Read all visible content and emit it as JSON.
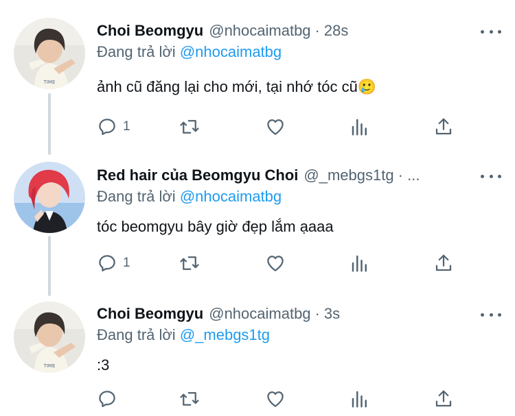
{
  "tweets": [
    {
      "name": "Choi Beomgyu",
      "handle": "@nhocaimatbg",
      "separator": "·",
      "time": "28s",
      "reply_prefix": "Đang trả lời",
      "reply_mention": "@nhocaimatbg",
      "text": "ảnh cũ đăng lại cho mới, tại nhớ tóc cũ🥲",
      "reply_count": "1"
    },
    {
      "name": "Red hair của Beomgyu Choi",
      "handle": "@_mebgs1tg · ...",
      "separator": "",
      "time": "",
      "reply_prefix": "Đang trả lời",
      "reply_mention": "@nhocaimatbg",
      "text": "tóc beomgyu bây giờ đẹp lắm ạaaa",
      "reply_count": "1"
    },
    {
      "name": "Choi Beomgyu",
      "handle": "@nhocaimatbg",
      "separator": "·",
      "time": "3s",
      "reply_prefix": "Đang trả lời",
      "reply_mention": "@_mebgs1tg",
      "text": ":3",
      "reply_count": ""
    }
  ],
  "icons": {
    "reply": "reply-icon",
    "retweet": "retweet-icon",
    "like": "heart-icon",
    "views": "views-icon",
    "share": "share-icon",
    "more": "more-icon"
  },
  "colors": {
    "mention": "#1d9bf0",
    "secondary_text": "#536471",
    "thread_line": "#cfd9de"
  }
}
